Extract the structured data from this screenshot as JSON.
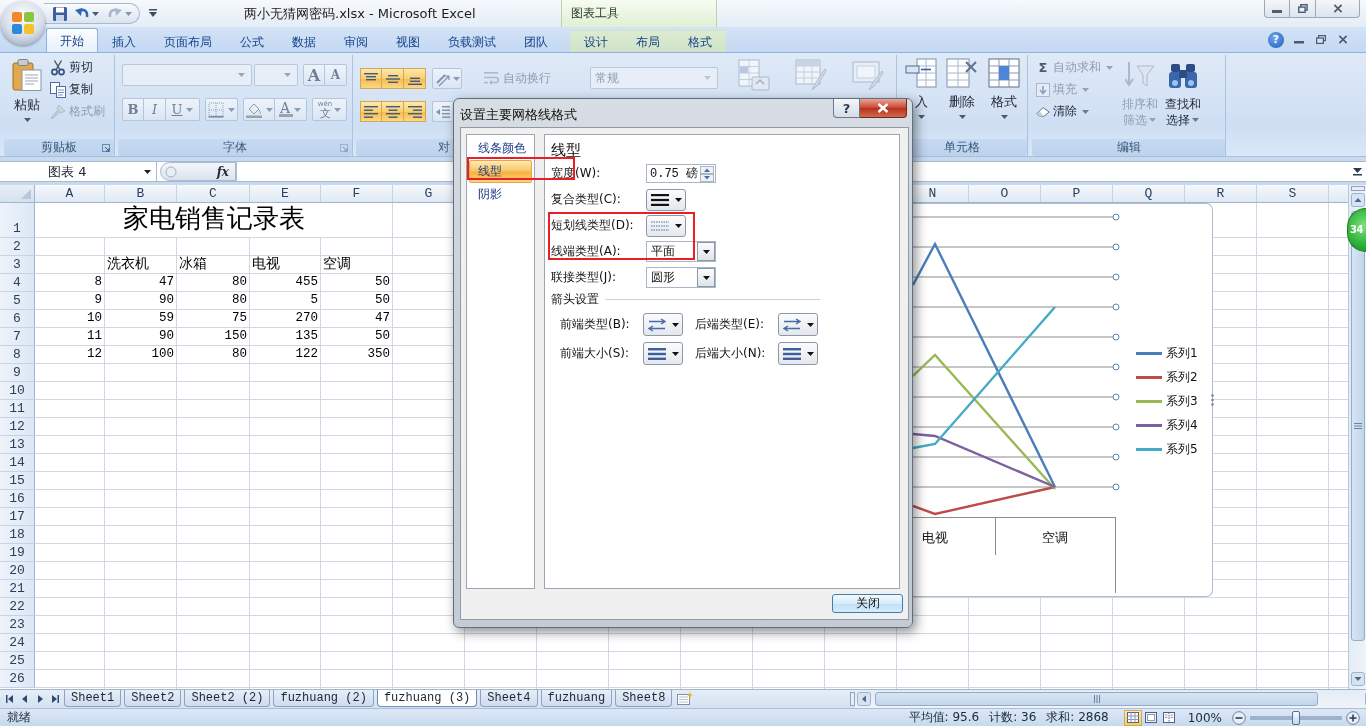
{
  "window": {
    "title": "两小无猜网密码.xlsx - Microsoft Excel",
    "context_group": "图表工具",
    "help": "?"
  },
  "ribbon_tabs": [
    {
      "label": "开始",
      "selected": true,
      "kind": "main"
    },
    {
      "label": "插入",
      "selected": false,
      "kind": "main"
    },
    {
      "label": "页面布局",
      "selected": false,
      "kind": "main"
    },
    {
      "label": "公式",
      "selected": false,
      "kind": "main"
    },
    {
      "label": "数据",
      "selected": false,
      "kind": "main"
    },
    {
      "label": "审阅",
      "selected": false,
      "kind": "main"
    },
    {
      "label": "视图",
      "selected": false,
      "kind": "main"
    },
    {
      "label": "负载测试",
      "selected": false,
      "kind": "main"
    },
    {
      "label": "团队",
      "selected": false,
      "kind": "main"
    },
    {
      "label": "设计",
      "selected": false,
      "kind": "context"
    },
    {
      "label": "布局",
      "selected": false,
      "kind": "context"
    },
    {
      "label": "格式",
      "selected": false,
      "kind": "context"
    }
  ],
  "ribbon": {
    "clipboard": {
      "title": "剪贴板",
      "paste": "粘贴",
      "tools": [
        {
          "kind": "cut",
          "label": "剪切",
          "disabled": false
        },
        {
          "kind": "copy",
          "label": "复制",
          "disabled": false
        },
        {
          "kind": "painter",
          "label": "格式刷",
          "disabled": true
        }
      ]
    },
    "font": {
      "title": "字体",
      "grow": "A",
      "shrink": "A",
      "styles": [
        {
          "kind": "bold",
          "glyph": "B"
        },
        {
          "kind": "italic",
          "glyph": "I"
        },
        {
          "kind": "underline",
          "glyph": "U"
        }
      ],
      "font_color": "A",
      "phonetic": {
        "ruby": "wén",
        "glyph": "文"
      }
    },
    "alignment": {
      "title": "对",
      "vertical": [
        {
          "kind": "top",
          "on": true
        },
        {
          "kind": "middle",
          "on": true
        },
        {
          "kind": "bottom",
          "on": true
        }
      ],
      "horizontal": [
        {
          "kind": "left",
          "on": true
        },
        {
          "kind": "center",
          "on": true
        },
        {
          "kind": "right",
          "on": true
        }
      ]
    },
    "wrap_text": {
      "label": "自动换行",
      "disabled": true
    },
    "number_format": {
      "value": "常规",
      "disabled": true
    },
    "styles": [
      {
        "kind": "conditional",
        "disabled": true
      },
      {
        "kind": "table",
        "disabled": true
      },
      {
        "kind": "cell",
        "disabled": true
      }
    ],
    "cells": {
      "title": "单元格",
      "buttons": [
        {
          "kind": "insert",
          "label": "入"
        },
        {
          "kind": "delete",
          "label": "删除"
        },
        {
          "kind": "format",
          "label": "格式"
        }
      ]
    },
    "editing": {
      "title": "编辑",
      "items": [
        {
          "kind": "sum",
          "symbol": "Σ",
          "label": "自动求和",
          "disabled": true
        },
        {
          "kind": "fill",
          "label": "填充",
          "disabled": true
        },
        {
          "kind": "clear",
          "label": "清除",
          "disabled": false
        }
      ],
      "big": [
        {
          "kind": "sort",
          "lines": [
            "排序和",
            "筛选"
          ],
          "disabled": true
        },
        {
          "kind": "find",
          "lines": [
            "查找和",
            "选择"
          ],
          "disabled": false
        }
      ]
    }
  },
  "formula_bar": {
    "name_box": "图表 4",
    "function_label": "fx"
  },
  "sheet": {
    "columns": [
      "A",
      "B",
      "C",
      "E",
      "F",
      "G",
      "N",
      "O",
      "P",
      "Q",
      "R",
      "S"
    ],
    "rows": [
      {
        "number": "1",
        "kind": "title",
        "cells": [
          "家电销售记录表"
        ]
      },
      {
        "number": "2"
      },
      {
        "number": "3",
        "kind": "labels",
        "cells": [
          "洗衣机",
          "冰箱",
          "电视",
          "空调"
        ]
      },
      {
        "number": "4",
        "kind": "values",
        "cells": [
          "8",
          "47",
          "80",
          "455",
          "50"
        ]
      },
      {
        "number": "5",
        "kind": "values",
        "cells": [
          "9",
          "90",
          "80",
          "5",
          "50"
        ]
      },
      {
        "number": "6",
        "kind": "values",
        "cells": [
          "10",
          "59",
          "75",
          "270",
          "47"
        ]
      },
      {
        "number": "7",
        "kind": "values",
        "cells": [
          "11",
          "90",
          "150",
          "135",
          "50"
        ]
      },
      {
        "number": "8",
        "kind": "values",
        "cells": [
          "12",
          "100",
          "80",
          "122",
          "350"
        ]
      },
      {
        "number": "9"
      },
      {
        "number": "10"
      },
      {
        "number": "11"
      },
      {
        "number": "12"
      },
      {
        "number": "13"
      },
      {
        "number": "14"
      },
      {
        "number": "15"
      },
      {
        "number": "16"
      },
      {
        "number": "17"
      },
      {
        "number": "18"
      },
      {
        "number": "19"
      },
      {
        "number": "20"
      },
      {
        "number": "21"
      },
      {
        "number": "22"
      },
      {
        "number": "23"
      },
      {
        "number": "24"
      },
      {
        "number": "25"
      },
      {
        "number": "26"
      }
    ]
  },
  "chart": {
    "category_labels": [
      "电视",
      "空调"
    ],
    "legend": [
      {
        "name": "系列1",
        "color": "#4a7ebb"
      },
      {
        "name": "系列2",
        "color": "#be4b48"
      },
      {
        "name": "系列3",
        "color": "#98b954"
      },
      {
        "name": "系列4",
        "color": "#7d60a0"
      },
      {
        "name": "系列5",
        "color": "#46aac5"
      }
    ]
  },
  "floating_ball": {
    "text": "34"
  },
  "dialog": {
    "title": "设置主要网格线格式",
    "help": "?",
    "nav": [
      {
        "label": "线条颜色",
        "selected": false
      },
      {
        "label": "线型",
        "selected": true
      },
      {
        "label": "阴影",
        "selected": false
      }
    ],
    "heading": "线型",
    "fields": [
      {
        "kind": "spin",
        "label": "宽度(W):",
        "value": "0.75 磅"
      },
      {
        "kind": "compound",
        "label": "复合类型(C):"
      },
      {
        "kind": "dash",
        "label": "短划线类型(D):"
      },
      {
        "kind": "combo",
        "label": "线端类型(A):",
        "value": "平面"
      },
      {
        "kind": "combo",
        "label": "联接类型(J):",
        "value": "圆形"
      }
    ],
    "arrow_section": "箭头设置",
    "arrow_fields": [
      {
        "kind": "arrow_type",
        "label": "前端类型(B):"
      },
      {
        "kind": "arrow_type",
        "label": "后端类型(E):"
      },
      {
        "kind": "arrow_size",
        "label": "前端大小(S):"
      },
      {
        "kind": "arrow_size",
        "label": "后端大小(N):"
      }
    ],
    "close": "关闭"
  },
  "annotations": [
    {
      "kind": "frame"
    },
    {
      "kind": "frame"
    }
  ],
  "sheet_tabs": [
    {
      "label": "Sheet1",
      "selected": false
    },
    {
      "label": "Sheet2",
      "selected": false
    },
    {
      "label": "Sheet2 (2)",
      "selected": false
    },
    {
      "label": "fuzhuang (2)",
      "selected": false
    },
    {
      "label": "fuzhuang (3)",
      "selected": true
    },
    {
      "label": "Sheet4",
      "selected": false
    },
    {
      "label": "fuzhuang",
      "selected": false
    },
    {
      "label": "Sheet8",
      "selected": false
    }
  ],
  "status_bar": {
    "state": "就绪",
    "average": "平均值: 95.6",
    "count": "计数: 36",
    "sum": "求和: 2868",
    "views": [
      {
        "kind": "normal",
        "selected": true
      },
      {
        "kind": "page_layout",
        "selected": false
      },
      {
        "kind": "page_break",
        "selected": false
      }
    ],
    "zoom": {
      "label": "100%",
      "level": 0.5
    }
  }
}
